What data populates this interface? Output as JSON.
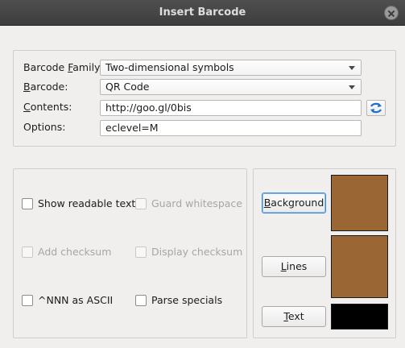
{
  "window": {
    "title": "Insert Barcode"
  },
  "barcode_group": {
    "family_label_pre": "Barcode ",
    "family_label_mn": "F",
    "family_label_post": "amily:",
    "family_value": "Two-dimensional symbols",
    "barcode_label_mn": "B",
    "barcode_label_post": "arcode:",
    "barcode_value": "QR Code",
    "contents_label_mn": "C",
    "contents_label_post": "ontents:",
    "contents_value": "http://goo.gl/0bis",
    "options_label": "Options:",
    "options_value": "eclevel=M",
    "swap_icon": "swap-arrows-icon"
  },
  "options_group": {
    "checkboxes": [
      {
        "label": "Show readable text",
        "checked": false,
        "enabled": true
      },
      {
        "label": "Guard whitespace",
        "checked": false,
        "enabled": false
      },
      {
        "label": "Add checksum",
        "checked": false,
        "enabled": false
      },
      {
        "label": "Display checksum",
        "checked": false,
        "enabled": false
      },
      {
        "label": "^NNN as ASCII",
        "checked": false,
        "enabled": true
      },
      {
        "label": "Parse specials",
        "checked": false,
        "enabled": true
      }
    ]
  },
  "colors_group": {
    "background_mn": "B",
    "background_post": "ackground",
    "lines_mn": "L",
    "lines_post": "ines",
    "text_mn": "T",
    "text_post": "ext",
    "background_color": "#9a6734",
    "lines_color": "#9a6734",
    "text_color": "#000000"
  }
}
